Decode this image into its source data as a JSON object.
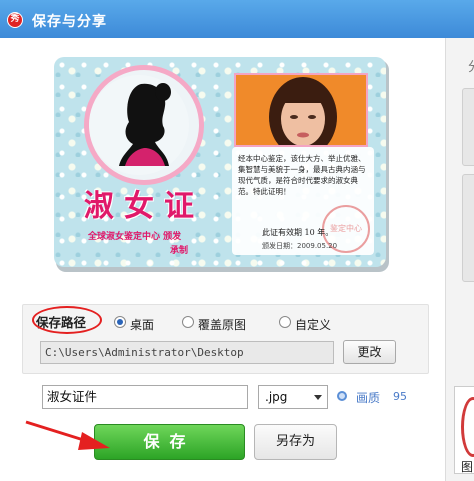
{
  "window": {
    "title": "保存与分享",
    "logo_char": "秀"
  },
  "side": {
    "tab_label": "分",
    "thumb_label": "图"
  },
  "certificate": {
    "title": "淑女证",
    "subtitle": "全球淑女鉴定中心 颁发",
    "subtitle2": "承制",
    "body": "经本中心鉴定，该仕大方、举止优雅、集智慧与美貌于一身，最具古典内涵与现代气质，是符合时代要求的淑女典范。特此证明！",
    "valid": "此证有效期 10 年。",
    "issue_date": "颁发日期：2009.05.20",
    "stamp_text": "鉴定中心"
  },
  "save_path": {
    "label": "保存路径",
    "options": [
      "桌面",
      "覆盖原图",
      "自定义"
    ],
    "selected": "桌面",
    "path_value": "C:\\Users\\Administrator\\Desktop",
    "change_button": "更改"
  },
  "file": {
    "name_value": "淑女证件",
    "format_value": ".jpg",
    "quality_label": "画质",
    "quality_value": "95"
  },
  "actions": {
    "save_label": "保存",
    "save_as_label": "另存为"
  },
  "colors": {
    "titlebar": "#3d8ad8",
    "save_button": "#2ca426",
    "annotation": "#e42020",
    "cert_pink": "#e0196a"
  }
}
